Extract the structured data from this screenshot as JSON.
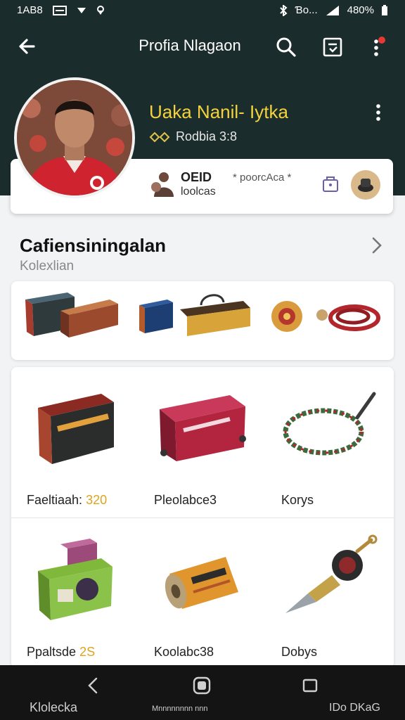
{
  "status_bar": {
    "time": "1AB8",
    "carrier": "Ɓo...",
    "battery": "480%"
  },
  "header": {
    "title": "Profia Nlagaon"
  },
  "profile": {
    "name": "Uaka Nanil- Iytka",
    "subtitle": "Rodbia 3:8"
  },
  "stats": {
    "label_primary": "OEID",
    "label_secondary": "loolcas",
    "tag": "* poorcAca *"
  },
  "section": {
    "title": "Cafiensiningalan",
    "subtitle": "Kolexlian"
  },
  "items": [
    {
      "label": "Faeltiaah:",
      "value": "320"
    },
    {
      "label": "Pleolabce3",
      "value": ""
    },
    {
      "label": "Korys",
      "value": ""
    },
    {
      "label": "Ppaltsde",
      "value": "2S"
    },
    {
      "label": "Koolabc38",
      "value": ""
    },
    {
      "label": "Dobys",
      "value": ""
    }
  ],
  "bottom_nav": {
    "left": "Klolecka",
    "center": "Mnnnnnnnn nnn",
    "right": "IDo DKaG"
  },
  "colors": {
    "header_bg": "#1b2c2c",
    "accent_yellow": "#f4d23c",
    "value_orange": "#e0a31e",
    "notify_red": "#e53935"
  },
  "icons": [
    "back-arrow-icon",
    "search-icon",
    "edit-icon",
    "more-vert-icon",
    "chevron-right-icon",
    "back-nav-icon",
    "home-nav-icon",
    "recents-nav-icon"
  ]
}
